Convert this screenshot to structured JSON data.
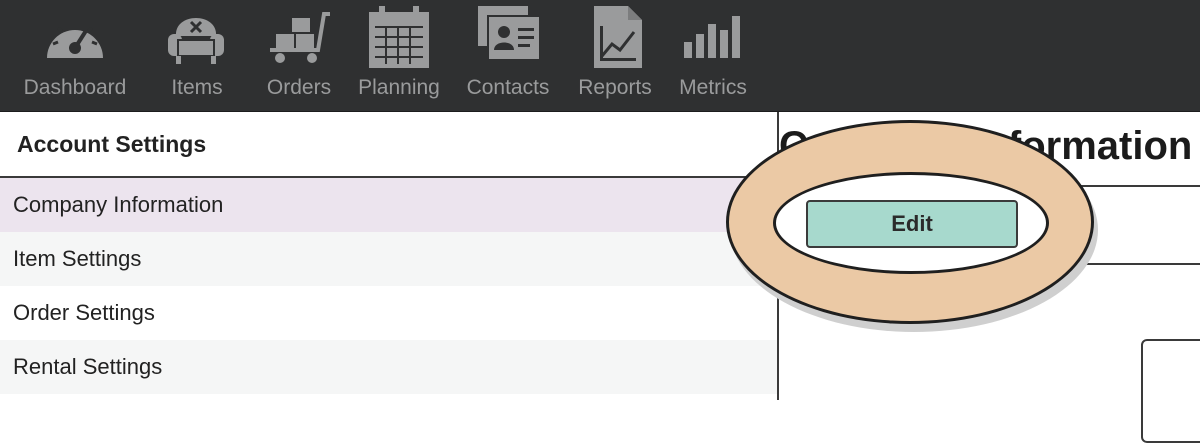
{
  "nav": {
    "items": [
      {
        "label": "Dashboard",
        "icon": "dashboard-gauge-icon"
      },
      {
        "label": "Items",
        "icon": "armchair-icon"
      },
      {
        "label": "Orders",
        "icon": "cart-icon"
      },
      {
        "label": "Planning",
        "icon": "calendar-icon"
      },
      {
        "label": "Contacts",
        "icon": "contact-card-icon"
      },
      {
        "label": "Reports",
        "icon": "report-document-icon"
      },
      {
        "label": "Metrics",
        "icon": "bar-chart-icon"
      }
    ]
  },
  "sidebar": {
    "title": "Account Settings",
    "items": [
      {
        "label": "Company Information",
        "selected": true
      },
      {
        "label": "Item Settings",
        "selected": false
      },
      {
        "label": "Order Settings",
        "selected": false
      },
      {
        "label": "Rental Settings",
        "selected": false
      }
    ]
  },
  "main": {
    "title": "Company Information",
    "edit_label": "Edit"
  },
  "colors": {
    "nav_bg": "#2f3031",
    "nav_icon": "#9a9b9c",
    "selected_row": "#ece4ee",
    "alt_row": "#f5f6f6",
    "edit_button": "#a7d9cd",
    "highlight_ring": "#ebc9a5"
  }
}
